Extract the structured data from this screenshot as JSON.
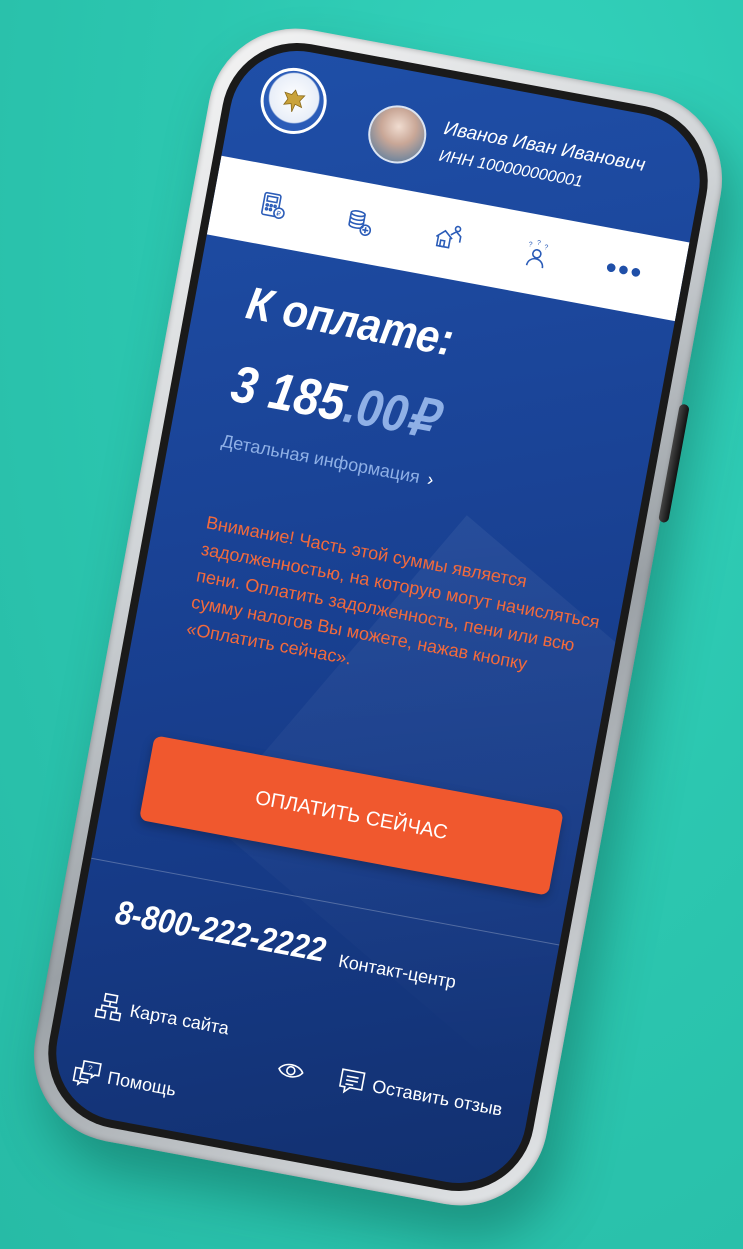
{
  "header": {
    "user_name": "Иванов Иван Иванович",
    "user_inn": "ИНН 100000000001"
  },
  "toolbar": {
    "icons": [
      "calculator-icon",
      "coins-icon",
      "property-icon",
      "questions-person-icon",
      "more-icon"
    ],
    "more_label": "•••"
  },
  "payment": {
    "title": "К оплате:",
    "amount_int": "3 185",
    "amount_frac": ".00₽",
    "detail_link": "Детальная информация",
    "detail_chevron": "›",
    "warning": "Внимание! Часть этой суммы является задолженностью, на которую могут начисляться пени. Оплатить задолженность, пени или всю сумму налогов Вы можете, нажав кнопку «Оплатить сейчас».",
    "pay_button": "ОПЛАТИТЬ СЕЙЧАС"
  },
  "footer": {
    "phone": "8-800-222-2222",
    "contact_label": "Контакт-центр",
    "sitemap": "Карта сайта",
    "feedback": "Оставить отзыв",
    "help": "Помощь"
  },
  "colors": {
    "background": "#2cc7b0",
    "screen": "#1a4396",
    "accent_orange": "#f0582e",
    "warning_text": "#f26a3c",
    "muted_blue": "#8fb0e6"
  }
}
